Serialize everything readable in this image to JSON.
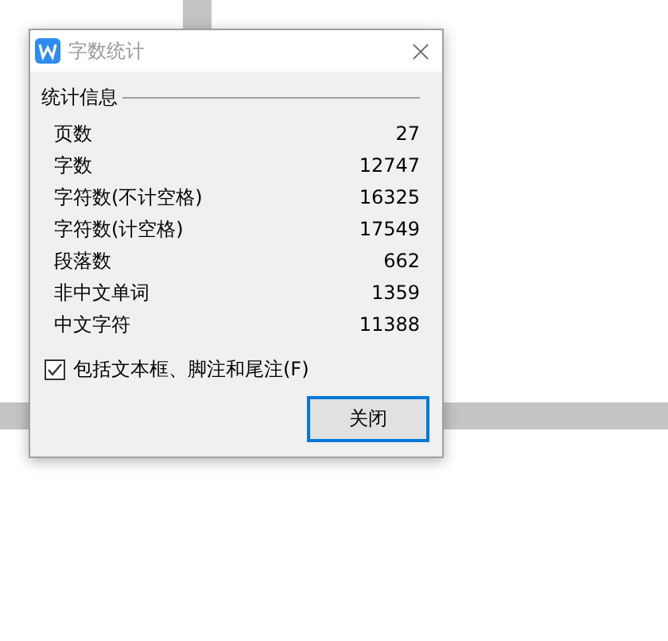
{
  "window": {
    "title": "字数统计"
  },
  "section": {
    "title": "统计信息"
  },
  "stats": [
    {
      "label": "页数",
      "value": "27"
    },
    {
      "label": "字数",
      "value": "12747"
    },
    {
      "label": "字符数(不计空格)",
      "value": "16325"
    },
    {
      "label": "字符数(计空格)",
      "value": "17549"
    },
    {
      "label": "段落数",
      "value": "662"
    },
    {
      "label": "非中文单词",
      "value": "1359"
    },
    {
      "label": "中文字符",
      "value": "11388"
    }
  ],
  "option": {
    "label": "包括文本框、脚注和尾注(F)",
    "checked": true
  },
  "buttons": [
    "关闭"
  ]
}
